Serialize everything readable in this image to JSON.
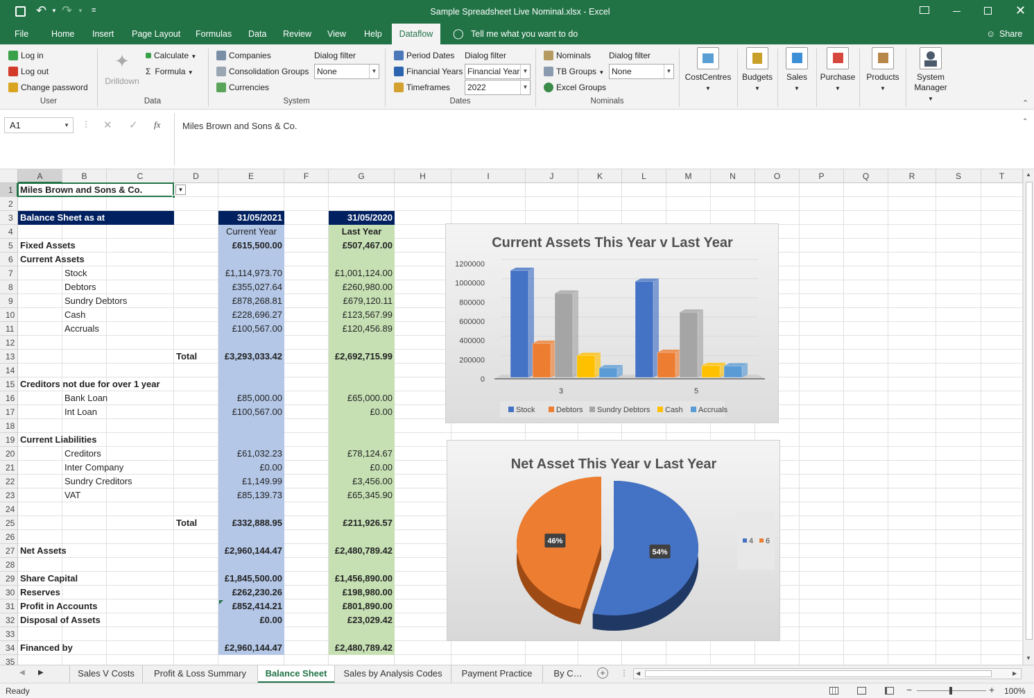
{
  "window": {
    "title": "Sample Spreadsheet Live Nominal.xlsx - Excel"
  },
  "ribbon_tabs": [
    "File",
    "Home",
    "Insert",
    "Page Layout",
    "Formulas",
    "Data",
    "Review",
    "View",
    "Help",
    "Dataflow"
  ],
  "tell_me": "Tell me what you want to do",
  "share": "Share",
  "ribbon": {
    "user": {
      "login": "Log in",
      "logout": "Log out",
      "change_password": "Change password",
      "group": "User"
    },
    "data": {
      "drilldown": "Drilldown",
      "calculate": "Calculate",
      "formula": "Formula",
      "group": "Data"
    },
    "system": {
      "companies": "Companies",
      "consolidation_groups": "Consolidation Groups",
      "currencies": "Currencies",
      "dialog_filter": "Dialog filter",
      "filter_value": "None",
      "group": "System"
    },
    "dates": {
      "period_dates": "Period Dates",
      "financial_years": "Financial Years",
      "timeframes": "Timeframes",
      "dialog_filter": "Dialog filter",
      "fy_value": "Financial Year",
      "year_value": "2022",
      "group": "Dates"
    },
    "nominals": {
      "nominals": "Nominals",
      "tb_groups": "TB Groups",
      "excel_groups": "Excel Groups",
      "dialog_filter": "Dialog filter",
      "filter_value": "None",
      "group": "Nominals"
    },
    "big_buttons": [
      "CostCentres",
      "Budgets",
      "Sales",
      "Purchase",
      "Products",
      "System Manager"
    ]
  },
  "formula_bar": {
    "name_box": "A1",
    "fx": "fx",
    "content": "Miles Brown and Sons & Co."
  },
  "columns": [
    "A",
    "B",
    "C",
    "D",
    "E",
    "F",
    "G",
    "H",
    "I",
    "J",
    "K",
    "L",
    "M",
    "N",
    "O",
    "P",
    "Q",
    "R",
    "S",
    "T"
  ],
  "rows": [
    "1",
    "2",
    "3",
    "4",
    "5",
    "6",
    "7",
    "8",
    "9",
    "10",
    "11",
    "12",
    "13",
    "14",
    "15",
    "16",
    "17",
    "18",
    "19",
    "20",
    "21",
    "22",
    "23",
    "24",
    "25",
    "26",
    "27",
    "28",
    "29",
    "30",
    "31",
    "32",
    "33",
    "34",
    "35"
  ],
  "sheet": {
    "a1": "Miles Brown and Sons & Co.",
    "a3": "Balance Sheet as at",
    "e3": "31/05/2021",
    "g3": "31/05/2020",
    "e4": "Current Year",
    "g4": "Last Year",
    "lines": [
      {
        "row": 5,
        "col": "A",
        "label": "Fixed Assets",
        "bold": true,
        "cy": "£615,500.00",
        "ly": "£507,467.00"
      },
      {
        "row": 6,
        "col": "A",
        "label": "Current Assets",
        "bold": true,
        "cy": "",
        "ly": ""
      },
      {
        "row": 7,
        "col": "B",
        "label": "Stock",
        "bold": false,
        "cy": "£1,114,973.70",
        "ly": "£1,001,124.00"
      },
      {
        "row": 8,
        "col": "B",
        "label": "Debtors",
        "bold": false,
        "cy": "£355,027.64",
        "ly": "£260,980.00"
      },
      {
        "row": 9,
        "col": "B",
        "label": "Sundry Debtors",
        "bold": false,
        "cy": "£878,268.81",
        "ly": "£679,120.11"
      },
      {
        "row": 10,
        "col": "B",
        "label": "Cash",
        "bold": false,
        "cy": "£228,696.27",
        "ly": "£123,567.99"
      },
      {
        "row": 11,
        "col": "B",
        "label": "Accruals",
        "bold": false,
        "cy": "£100,567.00",
        "ly": "£120,456.89"
      },
      {
        "row": 13,
        "col": "D",
        "label": "Total",
        "bold": true,
        "cy": "£3,293,033.42",
        "ly": "£2,692,715.99"
      },
      {
        "row": 15,
        "col": "A",
        "label": "Creditors not due for over 1 year",
        "bold": true,
        "cy": "",
        "ly": ""
      },
      {
        "row": 16,
        "col": "B",
        "label": "Bank Loan",
        "bold": false,
        "cy": "£85,000.00",
        "ly": "£65,000.00"
      },
      {
        "row": 17,
        "col": "B",
        "label": "Int Loan",
        "bold": false,
        "cy": "£100,567.00",
        "ly": "£0.00"
      },
      {
        "row": 19,
        "col": "A",
        "label": "Current Liabilities",
        "bold": true,
        "cy": "",
        "ly": ""
      },
      {
        "row": 20,
        "col": "B",
        "label": "Creditors",
        "bold": false,
        "cy": "£61,032.23",
        "ly": "£78,124.67"
      },
      {
        "row": 21,
        "col": "B",
        "label": "Inter Company",
        "bold": false,
        "cy": "£0.00",
        "ly": "£0.00"
      },
      {
        "row": 22,
        "col": "B",
        "label": "Sundry Creditors",
        "bold": false,
        "cy": "£1,149.99",
        "ly": "£3,456.00"
      },
      {
        "row": 23,
        "col": "B",
        "label": "VAT",
        "bold": false,
        "cy": "£85,139.73",
        "ly": "£65,345.90"
      },
      {
        "row": 25,
        "col": "D",
        "label": "Total",
        "bold": true,
        "cy": "£332,888.95",
        "ly": "£211,926.57"
      },
      {
        "row": 27,
        "col": "A",
        "label": "Net Assets",
        "bold": true,
        "cy": "£2,960,144.47",
        "ly": "£2,480,789.42"
      },
      {
        "row": 29,
        "col": "A",
        "label": "Share Capital",
        "bold": true,
        "cy": "£1,845,500.00",
        "ly": "£1,456,890.00"
      },
      {
        "row": 30,
        "col": "A",
        "label": "Reserves",
        "bold": true,
        "cy": "£262,230.26",
        "ly": "£198,980.00"
      },
      {
        "row": 31,
        "col": "A",
        "label": "Profit in Accounts",
        "bold": true,
        "cy": "£852,414.21",
        "ly": "£801,890.00"
      },
      {
        "row": 32,
        "col": "A",
        "label": "Disposal of Assets",
        "bold": true,
        "cy": "£0.00",
        "ly": "£23,029.42"
      },
      {
        "row": 34,
        "col": "A",
        "label": "Financed by",
        "bold": true,
        "cy": "£2,960,144.47",
        "ly": "£2,480,789.42"
      }
    ]
  },
  "chart_data": [
    {
      "type": "bar",
      "title": "Current Assets This Year v Last Year",
      "categories": [
        "3",
        "5"
      ],
      "ylim": [
        0,
        1200000
      ],
      "yticks": [
        "0",
        "200000",
        "400000",
        "600000",
        "800000",
        "1000000",
        "1200000"
      ],
      "legend_position": "bottom",
      "series": [
        {
          "name": "Stock",
          "color": "#4472c4",
          "values": [
            1114973.7,
            1001124.0
          ]
        },
        {
          "name": "Debtors",
          "color": "#ed7d31",
          "values": [
            355027.64,
            260980.0
          ]
        },
        {
          "name": "Sundry Debtors",
          "color": "#a5a5a5",
          "values": [
            878268.81,
            679120.11
          ]
        },
        {
          "name": "Cash",
          "color": "#ffc000",
          "values": [
            228696.27,
            123567.99
          ]
        },
        {
          "name": "Accruals",
          "color": "#5b9bd5",
          "values": [
            100567.0,
            120456.89
          ]
        }
      ]
    },
    {
      "type": "pie",
      "title": "Net Asset This Year v Last Year",
      "legend_position": "right",
      "slices": [
        {
          "name": "4",
          "value": 54,
          "label": "54%",
          "color": "#4472c4"
        },
        {
          "name": "6",
          "value": 46,
          "label": "46%",
          "color": "#ed7d31"
        }
      ]
    }
  ],
  "sheet_tabs": [
    "Sales V Costs",
    "Profit & Loss Summary",
    "Balance Sheet",
    "Sales by Analysis Codes",
    "Payment Practice",
    "By C…"
  ],
  "active_sheet": "Balance Sheet",
  "status": {
    "ready": "Ready",
    "zoom": "100%"
  }
}
